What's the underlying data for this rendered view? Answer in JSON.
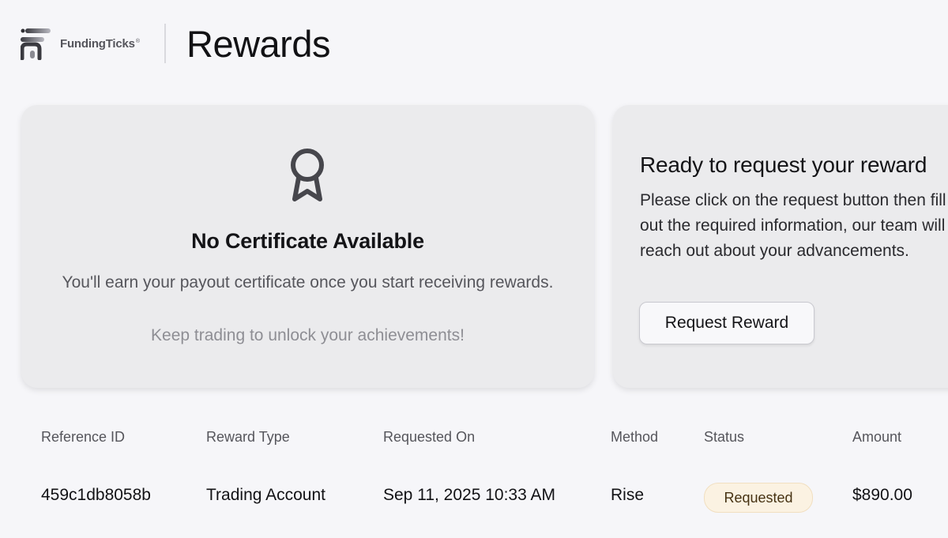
{
  "header": {
    "logo_text": "FundingTicks",
    "logo_trademark": "®",
    "title": "Rewards"
  },
  "certificate_card": {
    "icon": "ribbon-award-icon",
    "title": "No Certificate Available",
    "description": "You'll earn your payout certificate once you start receiving rewards.",
    "hint": "Keep trading to unlock your achievements!"
  },
  "request_card": {
    "title": "Ready to request your reward",
    "description": "Please click on the request button then fill out the required information, our team will reach out about your advancements.",
    "button_label": "Request Reward"
  },
  "table": {
    "headers": [
      "Reference ID",
      "Reward Type",
      "Requested On",
      "Method",
      "Status",
      "Amount"
    ],
    "rows": [
      {
        "reference_id": "459c1db8058b",
        "reward_type": "Trading Account",
        "requested_on": "Sep 11, 2025 10:33 AM",
        "method": "Rise",
        "status": "Requested",
        "amount": "$890.00"
      }
    ]
  },
  "colors": {
    "background": "#f6f6f9",
    "card": "#ebebed",
    "status_badge_bg": "#fbf2e2",
    "status_badge_border": "#f1dfc0"
  }
}
